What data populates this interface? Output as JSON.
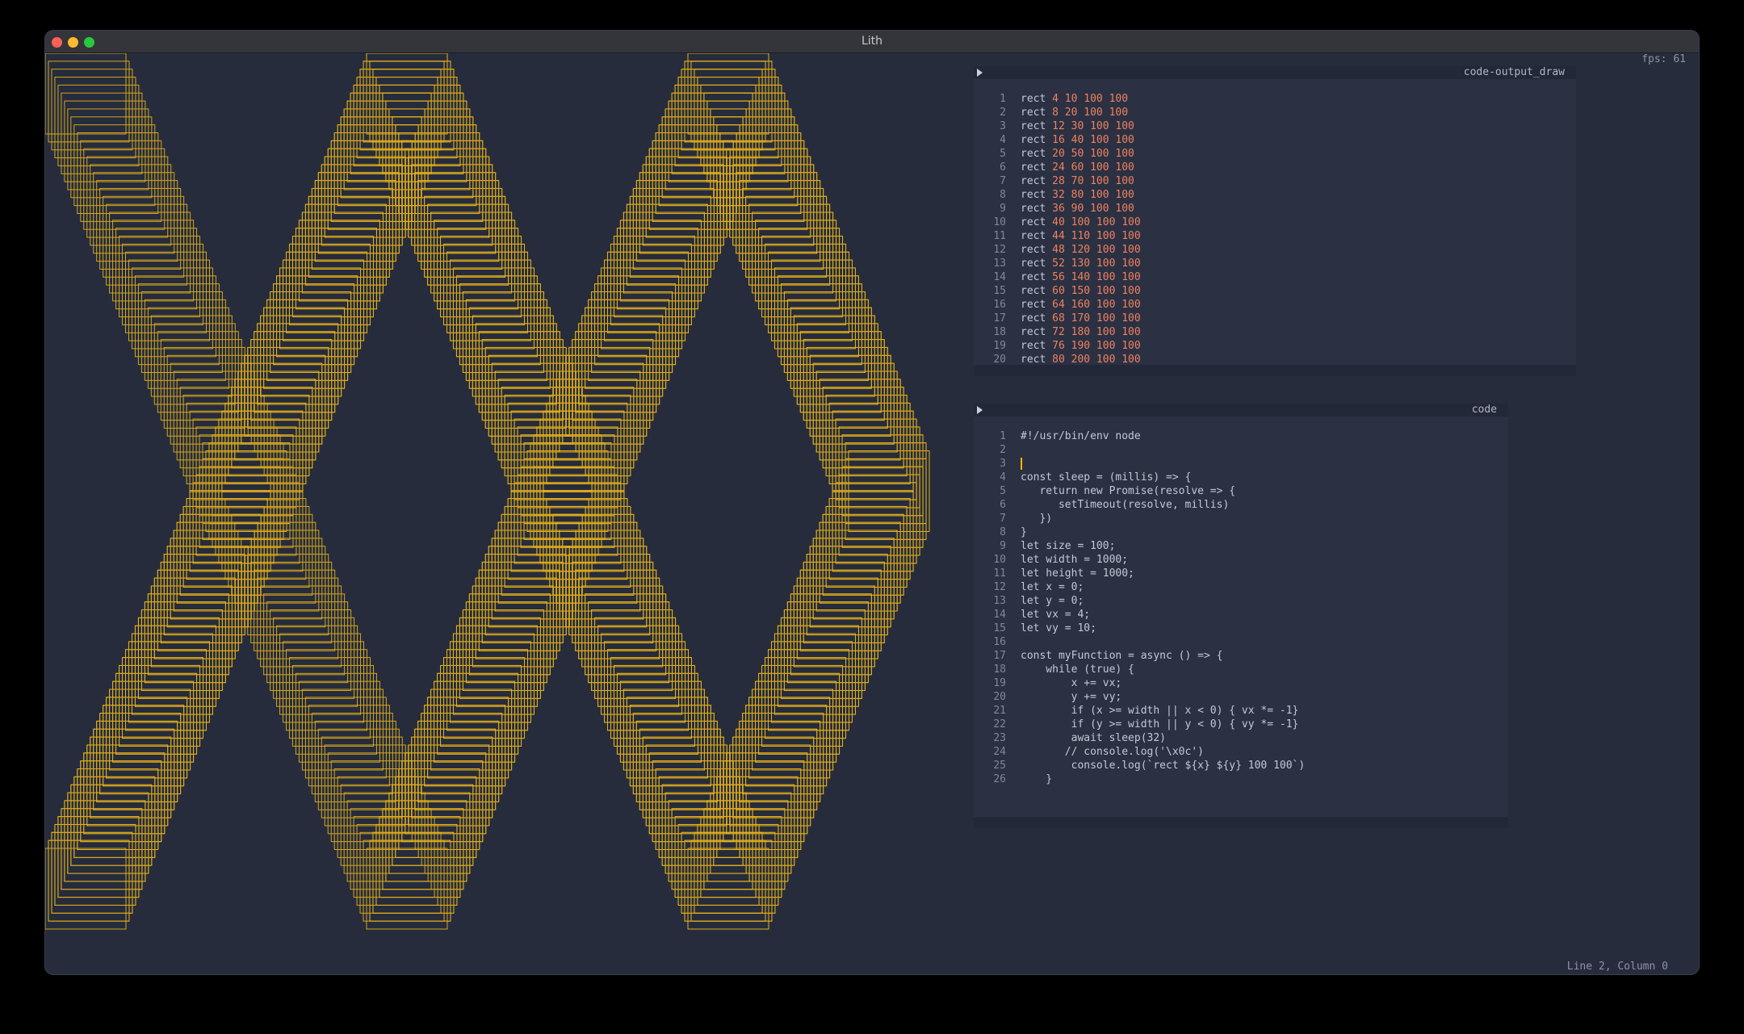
{
  "window": {
    "title": "Lith"
  },
  "fps": "fps: 61",
  "status_bar": "Line 2, Column 0",
  "output_panel": {
    "title": "code-output_draw",
    "lines": [
      "rect 4 10 100 100",
      "rect 8 20 100 100",
      "rect 12 30 100 100",
      "rect 16 40 100 100",
      "rect 20 50 100 100",
      "rect 24 60 100 100",
      "rect 28 70 100 100",
      "rect 32 80 100 100",
      "rect 36 90 100 100",
      "rect 40 100 100 100",
      "rect 44 110 100 100",
      "rect 48 120 100 100",
      "rect 52 130 100 100",
      "rect 56 140 100 100",
      "rect 60 150 100 100",
      "rect 64 160 100 100",
      "rect 68 170 100 100",
      "rect 72 180 100 100",
      "rect 76 190 100 100",
      "rect 80 200 100 100"
    ]
  },
  "code_panel": {
    "title": "code",
    "lines": [
      "#!/usr/bin/env node",
      "",
      "",
      "const sleep = (millis) => {",
      "   return new Promise(resolve => {",
      "      setTimeout(resolve, millis)",
      "   })",
      "}",
      "let size = 100;",
      "let width = 1000;",
      "let height = 1000;",
      "let x = 0;",
      "let y = 0;",
      "let vx = 4;",
      "let vy = 10;",
      "",
      "const myFunction = async () => {",
      "    while (true) {",
      "        x += vx;",
      "        y += vy;",
      "        if (x >= width || x < 0) { vx *= -1}",
      "        if (y >= width || y < 0) { vy *= -1}",
      "        await sleep(32)",
      "       // console.log('\\x0c')",
      "        console.log(`rect ${x} ${y} 100 100`)",
      "    }"
    ]
  },
  "colors": {
    "rect_stroke": "#e5b11a",
    "canvas_bg": "#262c3c"
  }
}
